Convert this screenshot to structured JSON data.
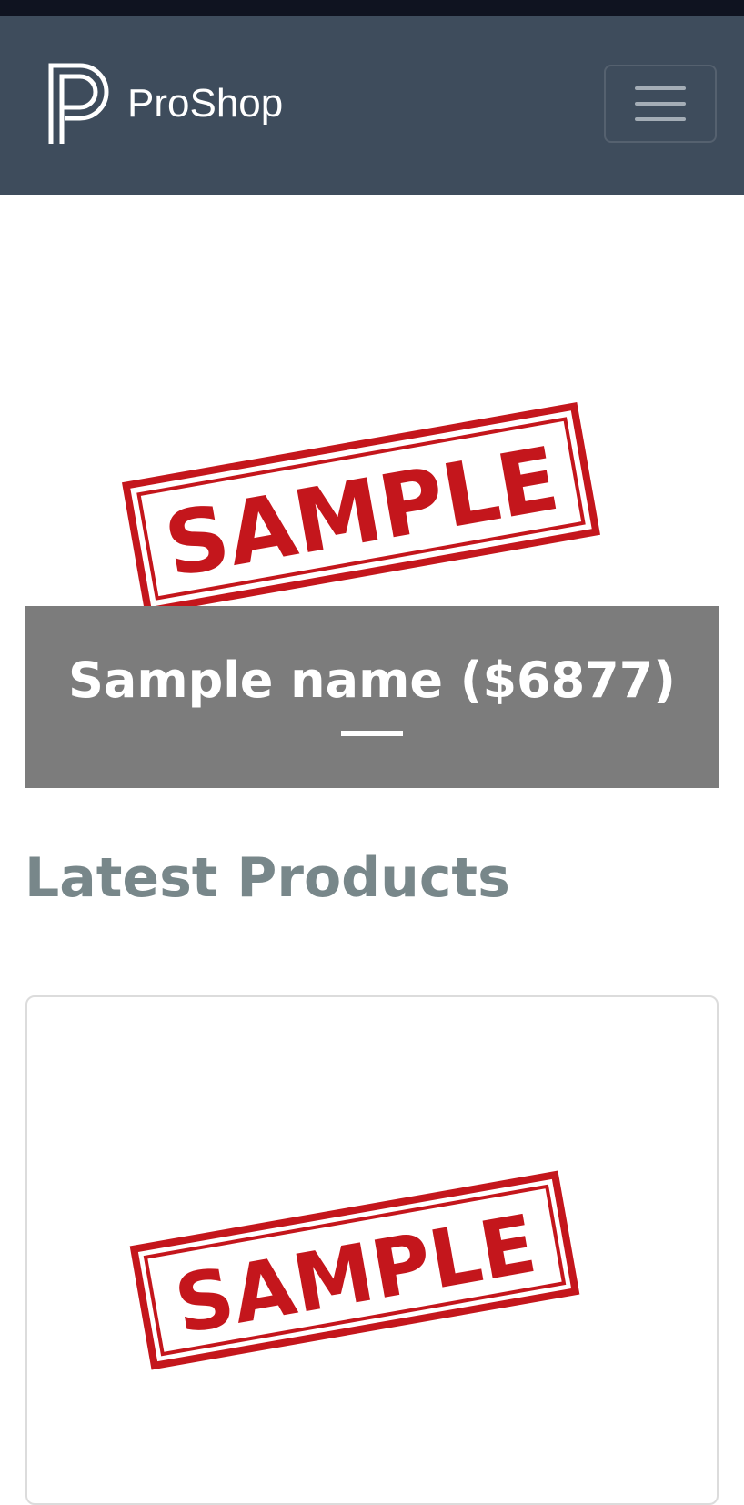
{
  "navbar": {
    "brand_name": "ProShop",
    "logo_letter": "P",
    "toggler_icon": "hamburger-menu-icon"
  },
  "carousel": {
    "caption": "Sample name ($6877)",
    "image_stamp_text": "SAMPLE"
  },
  "latest_products": {
    "title": "Latest Products",
    "products": [
      {
        "image_stamp_text": "SAMPLE"
      }
    ]
  },
  "colors": {
    "navbar_bg": "#3e4c5c",
    "caption_bg": "#7c7c7c",
    "stamp_red": "#c4161c",
    "section_title": "#78878a"
  }
}
